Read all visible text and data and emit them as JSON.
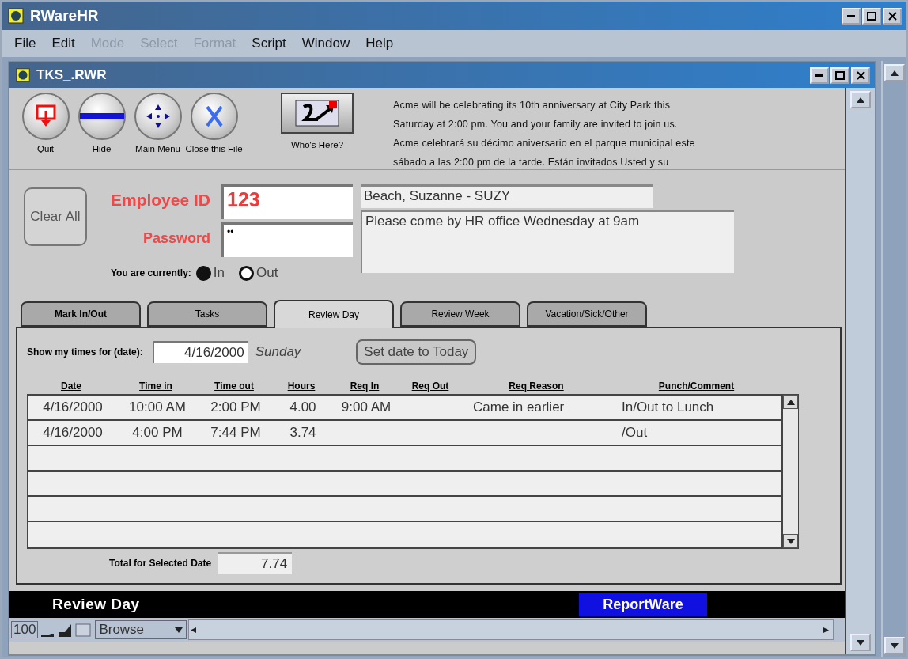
{
  "app_window": {
    "title": "RWareHR"
  },
  "menu": [
    {
      "label": "File",
      "disabled": false
    },
    {
      "label": "Edit",
      "disabled": false
    },
    {
      "label": "Mode",
      "disabled": true
    },
    {
      "label": "Select",
      "disabled": true
    },
    {
      "label": "Format",
      "disabled": true
    },
    {
      "label": "Script",
      "disabled": false
    },
    {
      "label": "Window",
      "disabled": false
    },
    {
      "label": "Help",
      "disabled": false
    }
  ],
  "document_window": {
    "title": "TKS_.RWR"
  },
  "toolbar": {
    "buttons": [
      {
        "kind": "quit",
        "label": "Quit"
      },
      {
        "kind": "hide",
        "label": "Hide"
      },
      {
        "kind": "main_menu",
        "label": "Main Menu"
      },
      {
        "kind": "close",
        "label": "Close this File"
      }
    ],
    "whos_here": "Who's Here?",
    "announcement": "Acme will be celebrating its 10th anniversary at City Park this\nSaturday at 2:00 pm.  You and your family are invited to join us.\nAcme celebrará su  décimo aniversario en el parque municipal este\nsábado a las 2:00 pm de la tarde.  Están invitados Usted y su"
  },
  "login": {
    "clear_button": "Clear All",
    "employee_id": {
      "label": "Employee ID",
      "value": "123"
    },
    "password": {
      "label": "Password",
      "value": "••"
    },
    "employee_name": "Beach, Suzanne  - SUZY",
    "message": "Please come by HR office Wednesday at 9am",
    "status": {
      "label": "You are currently:",
      "options": [
        {
          "label": "In",
          "selected": true
        },
        {
          "label": "Out",
          "selected": false
        }
      ]
    }
  },
  "tabs": [
    {
      "label": "Mark In/Out",
      "selected": false
    },
    {
      "label": "Tasks",
      "selected": false
    },
    {
      "label": "Review Day",
      "selected": true
    },
    {
      "label": "Review Week",
      "selected": false
    },
    {
      "label": "Vacation/Sick/Other",
      "selected": false
    }
  ],
  "review_day": {
    "date_field": {
      "label": "Show my times for (date):",
      "value": "4/16/2000"
    },
    "weekday": "Sunday",
    "today_button": "Set date to Today",
    "table": {
      "columns": [
        "Date",
        "Time in",
        "Time out",
        "Hours",
        "Req In",
        "Req Out",
        "Req Reason",
        "Punch/Comment"
      ],
      "rows": [
        {
          "date": "4/16/2000",
          "time_in": "10:00 AM",
          "time_out": "2:00 PM",
          "hours": "4.00",
          "req_in": "9:00 AM",
          "req_reason": "Came in earlier",
          "punch_comment": "In/Out to Lunch"
        },
        {
          "date": "4/16/2000",
          "time_in": "4:00 PM",
          "time_out": "7:44 PM",
          "hours": "3.74",
          "punch_comment": "/Out"
        }
      ]
    },
    "total": {
      "label": "Total for Selected Date",
      "value": "7.74"
    }
  },
  "status_bar": {
    "view_title": "Review Day",
    "brand": "ReportWare"
  },
  "bottom_bar": {
    "zoom": "100",
    "mode": "Browse"
  }
}
